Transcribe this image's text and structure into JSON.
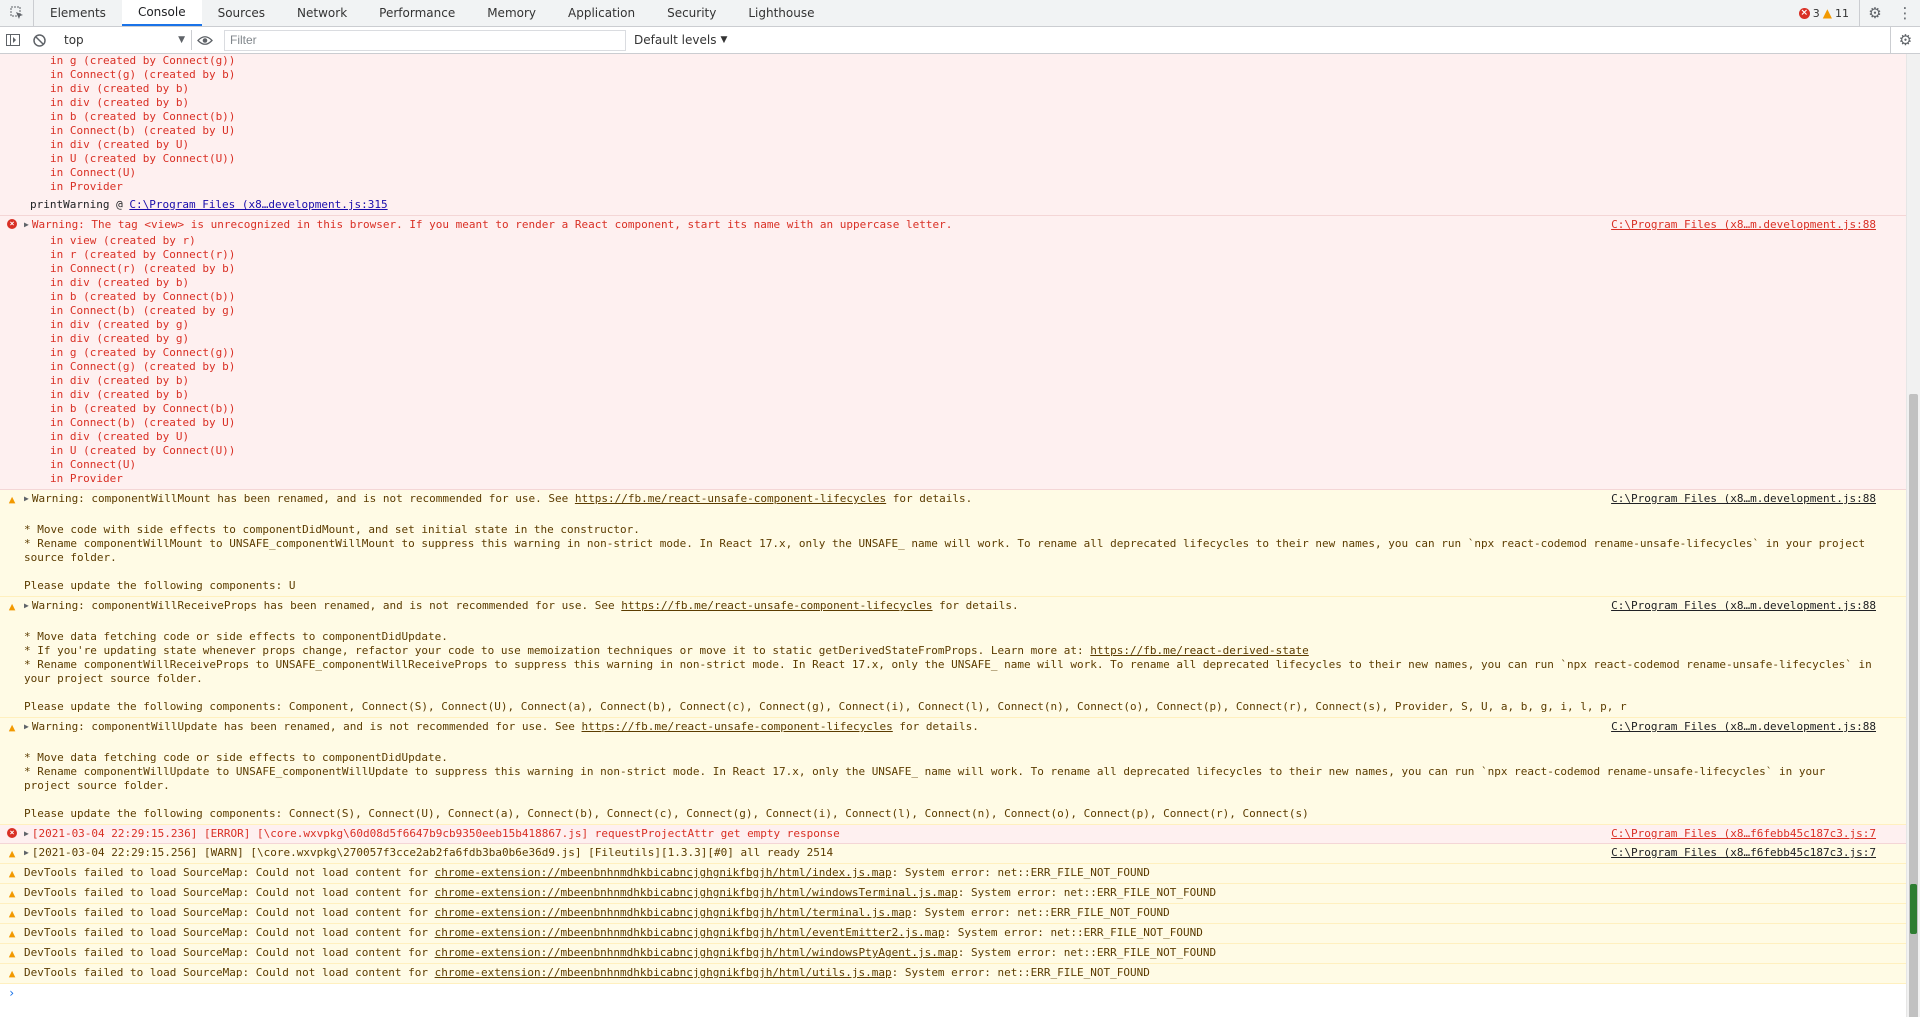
{
  "tabs": [
    "Elements",
    "Console",
    "Sources",
    "Network",
    "Performance",
    "Memory",
    "Application",
    "Security",
    "Lighthouse"
  ],
  "active_tab": "Console",
  "counts": {
    "errors": "3",
    "warnings": "11"
  },
  "toolbar": {
    "context": "top",
    "filter_placeholder": "Filter",
    "levels": "Default levels"
  },
  "msg1": {
    "stack": "in g (created by Connect(g))\nin Connect(g) (created by b)\nin div (created by b)\nin div (created by b)\nin b (created by Connect(b))\nin Connect(b) (created by U)\nin div (created by U)\nin U (created by Connect(U))\nin Connect(U)\nin Provider",
    "pw_label": "printWarning @ ",
    "pw_link": "C:\\Program Files (x8…development.js:315"
  },
  "msg2": {
    "text": "Warning: The tag <view> is unrecognized in this browser. If you meant to render a React component, start its name with an uppercase letter.",
    "source": "C:\\Program Files (x8…m.development.js:88",
    "stack": "in view (created by r)\nin r (created by Connect(r))\nin Connect(r) (created by b)\nin div (created by b)\nin b (created by Connect(b))\nin Connect(b) (created by g)\nin div (created by g)\nin div (created by g)\nin g (created by Connect(g))\nin Connect(g) (created by b)\nin div (created by b)\nin div (created by b)\nin b (created by Connect(b))\nin Connect(b) (created by U)\nin div (created by U)\nin U (created by Connect(U))\nin Connect(U)\nin Provider"
  },
  "msg3": {
    "text_a": "Warning: componentWillMount has been renamed, and is not recommended for use. See ",
    "link": "https://fb.me/react-unsafe-component-lifecycles",
    "text_b": " for details.",
    "source": "C:\\Program Files (x8…m.development.js:88",
    "detail": "\n* Move code with side effects to componentDidMount, and set initial state in the constructor.\n* Rename componentWillMount to UNSAFE_componentWillMount to suppress this warning in non-strict mode. In React 17.x, only the UNSAFE_ name will work. To rename all deprecated lifecycles to their new names, you can run `npx react-codemod rename-unsafe-lifecycles` in your project source folder.\n\nPlease update the following components: U"
  },
  "msg4": {
    "text_a": "Warning: componentWillReceiveProps has been renamed, and is not recommended for use. See ",
    "link": "https://fb.me/react-unsafe-component-lifecycles",
    "text_b": " for details.",
    "source": "C:\\Program Files (x8…m.development.js:88",
    "detail_a": "\n* Move data fetching code or side effects to componentDidUpdate.\n* If you're updating state whenever props change, refactor your code to use memoization techniques or move it to static getDerivedStateFromProps. Learn more at: ",
    "detail_link": "https://fb.me/react-derived-state",
    "detail_b": "\n* Rename componentWillReceiveProps to UNSAFE_componentWillReceiveProps to suppress this warning in non-strict mode. In React 17.x, only the UNSAFE_ name will work. To rename all deprecated lifecycles to their new names, you can run `npx react-codemod rename-unsafe-lifecycles` in your project source folder.\n\nPlease update the following components: Component, Connect(S), Connect(U), Connect(a), Connect(b), Connect(c), Connect(g), Connect(i), Connect(l), Connect(n), Connect(o), Connect(p), Connect(r), Connect(s), Provider, S, U, a, b, g, i, l, p, r"
  },
  "msg5": {
    "text_a": "Warning: componentWillUpdate has been renamed, and is not recommended for use. See ",
    "link": "https://fb.me/react-unsafe-component-lifecycles",
    "text_b": " for details.",
    "source": "C:\\Program Files (x8…m.development.js:88",
    "detail": "\n* Move data fetching code or side effects to componentDidUpdate.\n* Rename componentWillUpdate to UNSAFE_componentWillUpdate to suppress this warning in non-strict mode. In React 17.x, only the UNSAFE_ name will work. To rename all deprecated lifecycles to their new names, you can run `npx react-codemod rename-unsafe-lifecycles` in your project source folder.\n\nPlease update the following components: Connect(S), Connect(U), Connect(a), Connect(b), Connect(c), Connect(g), Connect(i), Connect(l), Connect(n), Connect(o), Connect(p), Connect(r), Connect(s)"
  },
  "msg6": {
    "text": "[2021-03-04 22:29:15.236] [ERROR] [\\core.wxvpkg\\60d08d5f6647b9cb9350eeb15b418867.js] requestProjectAttr get empty response",
    "source": "C:\\Program Files (x8…f6febb45c187c3.js:7"
  },
  "msg7": {
    "text": "[2021-03-04 22:29:15.256] [WARN] [\\core.wxvpkg\\270057f3cce2ab2fa6fdb3ba0b6e36d9.js] [Fileutils][1.3.3][#0] all ready 2514",
    "source": "C:\\Program Files (x8…f6febb45c187c3.js:7"
  },
  "sourcemap": {
    "prefix": "DevTools failed to load SourceMap: Could not load content for ",
    "suffix": ": System error: net::ERR_FILE_NOT_FOUND",
    "urls": [
      "chrome-extension://mbeenbnhnmdhkbicabncjghgnikfbgjh/html/index.js.map",
      "chrome-extension://mbeenbnhnmdhkbicabncjghgnikfbgjh/html/windowsTerminal.js.map",
      "chrome-extension://mbeenbnhnmdhkbicabncjghgnikfbgjh/html/terminal.js.map",
      "chrome-extension://mbeenbnhnmdhkbicabncjghgnikfbgjh/html/eventEmitter2.js.map",
      "chrome-extension://mbeenbnhnmdhkbicabncjghgnikfbgjh/html/windowsPtyAgent.js.map",
      "chrome-extension://mbeenbnhnmdhkbicabncjghgnikfbgjh/html/utils.js.map"
    ]
  },
  "prompt": "›"
}
